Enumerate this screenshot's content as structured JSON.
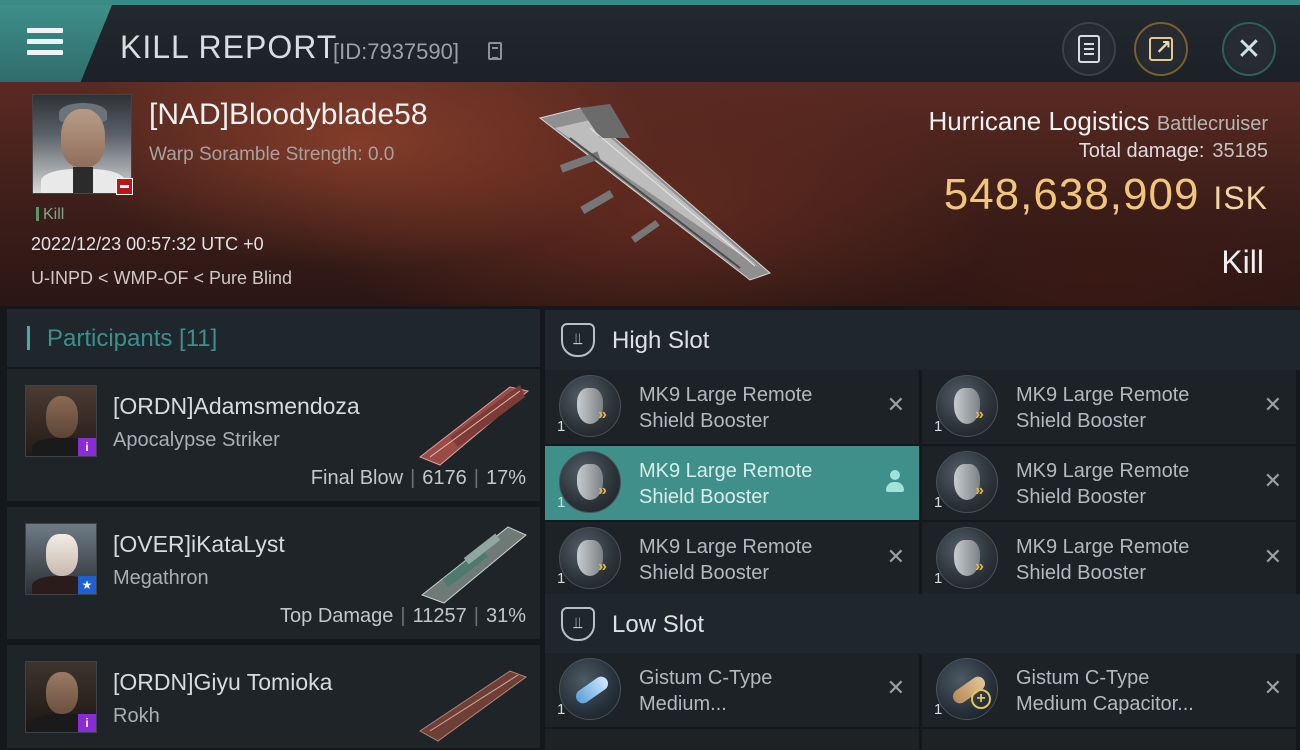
{
  "header": {
    "title": "KILL REPORT",
    "report_id": "[ID:7937590]"
  },
  "victim": {
    "name": "[NAD]Bloodyblade58",
    "warp_scramble": "Warp Soramble Strength: 0.0",
    "kill_tag": "Kill",
    "datetime": "2022/12/23 00:57:32 UTC +0",
    "location": "U-INPD < WMP-OF < Pure Blind",
    "ship_name": "Hurricane Logistics",
    "ship_class": "Battlecruiser",
    "total_damage_label": "Total damage:",
    "total_damage": "35185",
    "isk_value": "548,638,909",
    "isk_unit": "ISK",
    "result": "Kill"
  },
  "participants": {
    "label": "Participants [11]",
    "items": [
      {
        "name": "[ORDN]Adamsmendoza",
        "ship": "Apocalypse Striker",
        "role": "Final Blow",
        "damage": "6176",
        "percent": "17%",
        "badge": "i",
        "badge_color": "#8a2bd6"
      },
      {
        "name": "[OVER]iKataLyst",
        "ship": "Megathron",
        "role": "Top Damage",
        "damage": "11257",
        "percent": "31%",
        "badge": "★",
        "badge_color": "#1e5fd1"
      },
      {
        "name": "[ORDN]Giyu Tomioka",
        "ship": "Rokh",
        "role": "",
        "damage": "",
        "percent": "",
        "badge": "i",
        "badge_color": "#8a2bd6"
      }
    ]
  },
  "high_slot": {
    "label": "High Slot",
    "modules": [
      {
        "line1": "MK9 Large Remote",
        "line2": "Shield Booster",
        "qty": "1"
      },
      {
        "line1": "MK9 Large Remote",
        "line2": "Shield Booster",
        "qty": "1"
      },
      {
        "line1": "MK9 Large Remote",
        "line2": "Shield Booster",
        "qty": "1"
      },
      {
        "line1": "MK9 Large Remote",
        "line2": "Shield Booster",
        "qty": "1"
      },
      {
        "line1": "MK9 Large Remote",
        "line2": "Shield Booster",
        "qty": "1"
      },
      {
        "line1": "MK9 Large Remote",
        "line2": "Shield Booster",
        "qty": "1"
      }
    ]
  },
  "low_slot": {
    "label": "Low Slot",
    "modules": [
      {
        "line1": "Gistum C-Type",
        "line2": "Medium...",
        "qty": "1"
      },
      {
        "line1": "Gistum C-Type",
        "line2": "Medium Capacitor...",
        "qty": "1"
      }
    ]
  },
  "colors": {
    "accent_teal": "#3f8f8a",
    "isk_gold": "#f0c77a",
    "kill_red": "#c0141a"
  },
  "icons": {
    "menu": "menu-icon",
    "clipboard": "clipboard-icon",
    "share": "share-icon",
    "close": "close-icon"
  }
}
